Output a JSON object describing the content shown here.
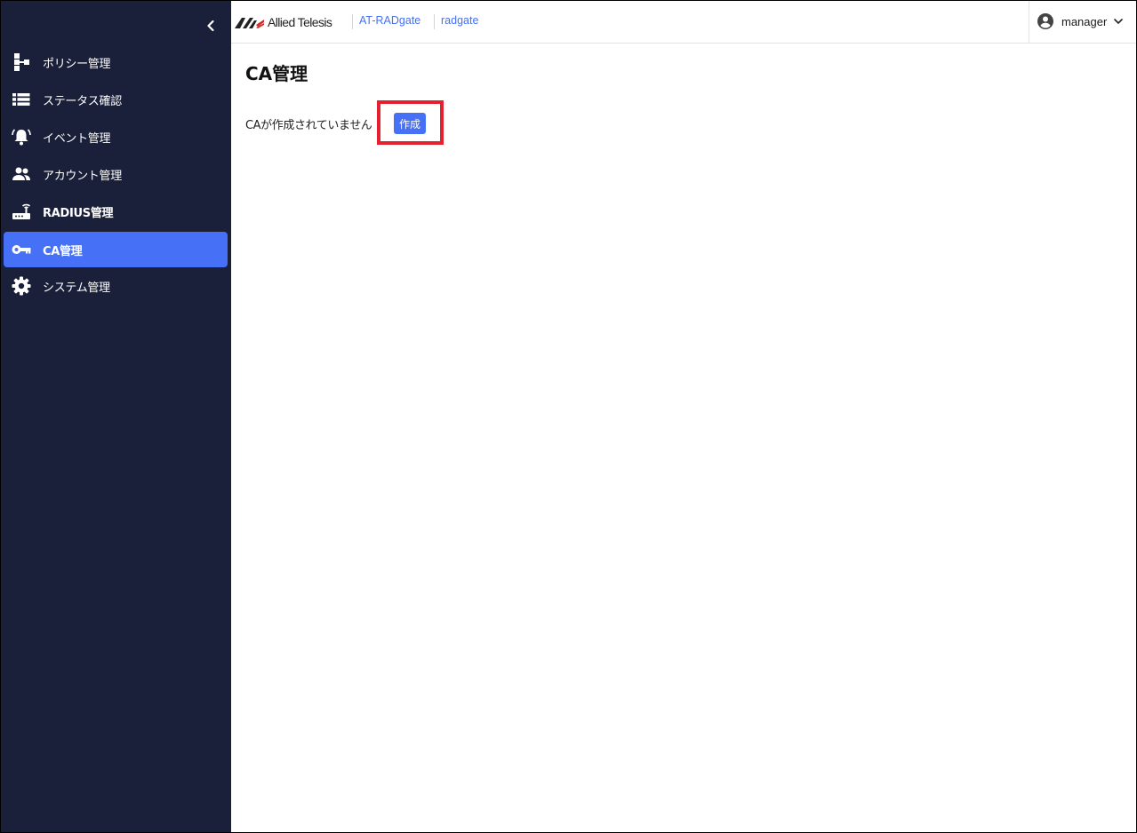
{
  "brand": {
    "logo_text": "Allied Telesis"
  },
  "header": {
    "product": "AT-RADgate",
    "hostname": "radgate",
    "user": "manager"
  },
  "sidebar": {
    "items": [
      {
        "label": "ポリシー管理",
        "icon": "policy-tree-icon",
        "active": false
      },
      {
        "label": "ステータス確認",
        "icon": "list-icon",
        "active": false
      },
      {
        "label": "イベント管理",
        "icon": "alarm-bell-icon",
        "active": false
      },
      {
        "label": "アカウント管理",
        "icon": "people-icon",
        "active": false
      },
      {
        "label": "RADIUS管理",
        "icon": "router-icon",
        "active": false
      },
      {
        "label": "CA管理",
        "icon": "key-icon",
        "active": true
      },
      {
        "label": "システム管理",
        "icon": "gear-icon",
        "active": false
      }
    ]
  },
  "main": {
    "title": "CA管理",
    "empty_message": "CAが作成されていません",
    "create_label": "作成"
  },
  "colors": {
    "sidebar_bg": "#1a2039",
    "accent": "#4670f5",
    "highlight": "#e4222f"
  }
}
